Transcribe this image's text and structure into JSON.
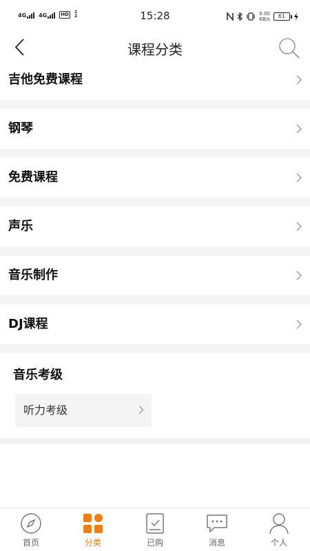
{
  "status_bar": {
    "network_1": "4G",
    "network_2": "4G",
    "hd_label": "HD",
    "hd_index": "1 2",
    "time": "15:28",
    "speed_value": "0.00",
    "speed_unit": "KB/s",
    "battery": "61",
    "icons": [
      "nfc-icon",
      "bluetooth-icon",
      "vibrate-icon",
      "battery-icon",
      "charging-icon"
    ]
  },
  "nav": {
    "title": "课程分类",
    "back_icon": "chevron-left-icon",
    "search_icon": "search-icon"
  },
  "categories": [
    {
      "label": "吉他免费课程"
    },
    {
      "label": "钢琴"
    },
    {
      "label": "免费课程"
    },
    {
      "label": "声乐"
    },
    {
      "label": "音乐制作"
    },
    {
      "label": "DJ课程"
    }
  ],
  "section": {
    "title": "音乐考级",
    "items": [
      {
        "label": "听力考级"
      }
    ]
  },
  "tabs": [
    {
      "label": "首页",
      "icon": "compass-icon"
    },
    {
      "label": "分类",
      "icon": "grid-icon",
      "active": true
    },
    {
      "label": "已购",
      "icon": "purchased-icon"
    },
    {
      "label": "消息",
      "icon": "message-icon"
    },
    {
      "label": "个人",
      "icon": "person-icon"
    }
  ],
  "colors": {
    "accent": "#f57c0a",
    "separator": "#f4f4f4",
    "tab_inactive": "#666666"
  }
}
